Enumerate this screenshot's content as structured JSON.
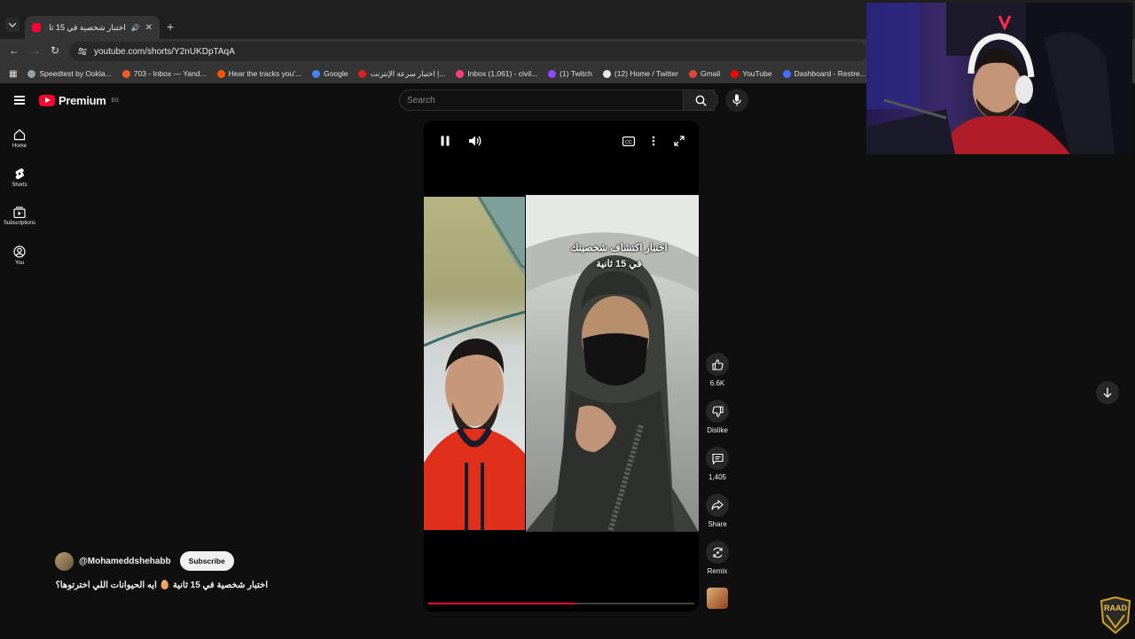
{
  "browser": {
    "tab_title": "اختبار شخصية في 15 ثا (77)",
    "url": "youtube.com/shorts/Y2nUKDpTAqA",
    "bookmarks": [
      {
        "label": "Speedtest by Ookla...",
        "color": "#9aa0a6"
      },
      {
        "label": "703 - Inbox — Yand...",
        "color": "#f05a28"
      },
      {
        "label": "Hear the tracks you'...",
        "color": "#ff5500"
      },
      {
        "label": "Google",
        "color": "#4285f4"
      },
      {
        "label": "اختبار سرعة الإنترنت |...",
        "color": "#e02020"
      },
      {
        "label": "Inbox (1,061) - civil...",
        "color": "#ff4080"
      },
      {
        "label": "(1) Twitch",
        "color": "#9146ff"
      },
      {
        "label": "(12) Home / Twitter",
        "color": "#e8e8e8"
      },
      {
        "label": "Gmail",
        "color": "#ea4335"
      },
      {
        "label": "YouTube",
        "color": "#ff0000"
      },
      {
        "label": "Dashboard - Restre...",
        "color": "#4a6cf7"
      }
    ]
  },
  "youtube": {
    "logo_text": "Premium",
    "region": "EG",
    "search_placeholder": "Search",
    "guide": [
      {
        "label": "Home",
        "icon": "home-icon"
      },
      {
        "label": "Shorts",
        "icon": "shorts-icon"
      },
      {
        "label": "Subscriptions",
        "icon": "subscriptions-icon"
      },
      {
        "label": "You",
        "icon": "you-icon"
      }
    ]
  },
  "short": {
    "caption": "اختبار اكتشاف شخصيتك في 15 ثانية",
    "progress_percent": 55,
    "actions": {
      "likes": "6.6K",
      "dislike_label": "Dislike",
      "comments": "1,405",
      "share_label": "Share",
      "remix_label": "Remix"
    },
    "channel": "@Mohameddshehabb",
    "subscribe_label": "Subscribe",
    "title": "اختبار شخصية في 15 ثانية 🥚 ايه الحيوانات اللي اخترتوها؟"
  },
  "colors": {
    "accent": "#ff0033",
    "background": "#0f0f0f"
  }
}
